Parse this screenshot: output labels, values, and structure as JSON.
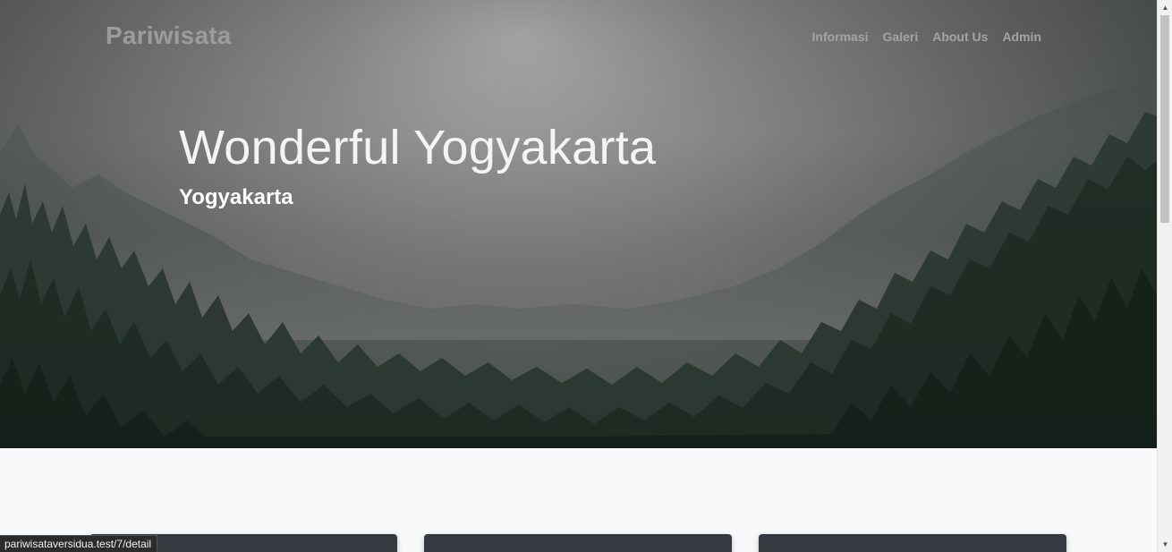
{
  "navbar": {
    "brand": "Pariwisata",
    "links": [
      "Informasi",
      "Galeri",
      "About Us",
      "Admin"
    ]
  },
  "hero": {
    "title": "Wonderful Yogyakarta",
    "subtitle": "Yogyakarta",
    "background": "misty-forest-photo"
  },
  "status_bar": {
    "url": "pariwisataversidua.test/7/detail"
  },
  "scrollbar": {
    "up_icon": "scroll-up-arrow-icon",
    "down_icon": "scroll-down-arrow-icon"
  },
  "colors": {
    "card": "#343a40",
    "page_background": "#f8f9fa"
  }
}
